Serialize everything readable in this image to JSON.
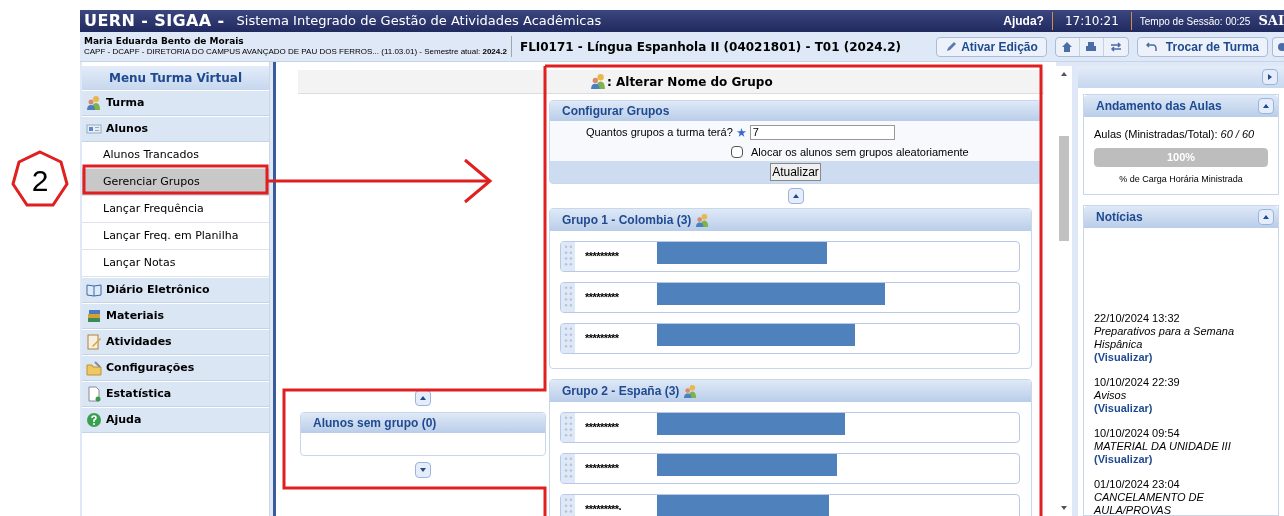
{
  "annotation": {
    "badge": "2"
  },
  "header": {
    "system": "UERN - SIGAA -",
    "title": "Sistema Integrado de Gestão de Atividades Acadêmicas",
    "help": "Ajuda?",
    "clock": "17:10:21",
    "session": "Tempo de Sessão: 00:25",
    "logout": "SAI"
  },
  "user": {
    "name": "Maria Eduarda Bento de Morais",
    "unit": "CAPF - DCAPF - DIRETORIA DO CAMPUS AVANÇADO DE PAU DOS FERROS... (11.03.01) - Semestre atual: **2024.2**"
  },
  "course": "FLI0171 - Língua Espanhola II (04021801) - T01 (2024.2)",
  "toolbar": {
    "edit": "Ativar Edição",
    "switch": "Trocar de Turma"
  },
  "sidebar": {
    "title": "Menu Turma Virtual",
    "items": [
      {
        "label": "Turma",
        "kind": "section",
        "selected": false
      },
      {
        "label": "Alunos",
        "kind": "section",
        "selected": false
      },
      {
        "label": "Alunos Trancados",
        "kind": "sub",
        "selected": false
      },
      {
        "label": "Gerenciar Grupos",
        "kind": "sub",
        "selected": true
      },
      {
        "label": "Lançar Frequência",
        "kind": "sub",
        "selected": false
      },
      {
        "label": "Lançar Freq. em Planilha",
        "kind": "sub",
        "selected": false
      },
      {
        "label": "Lançar Notas",
        "kind": "sub",
        "selected": false
      },
      {
        "label": "Diário Eletrônico",
        "kind": "section",
        "selected": false
      },
      {
        "label": "Materiais",
        "kind": "section",
        "selected": false
      },
      {
        "label": "Atividades",
        "kind": "section",
        "selected": false
      },
      {
        "label": "Configurações",
        "kind": "section",
        "selected": false
      },
      {
        "label": "Estatística",
        "kind": "section",
        "selected": false
      },
      {
        "label": "Ajuda",
        "kind": "section",
        "selected": false
      }
    ]
  },
  "legend": ": Alterar Nome do Grupo",
  "config": {
    "title": "Configurar Grupos",
    "question": "Quantos grupos a turma terá?",
    "value": "7",
    "random_label": "Alocar os alunos sem grupos aleatoriamente",
    "random_checked": false,
    "button": "Atualizar"
  },
  "unassigned": {
    "title": "Alunos sem grupo (0)"
  },
  "groups": [
    {
      "title": "Grupo 1 - Colombia (3)",
      "members": [
        "*********",
        "*********",
        "*********"
      ]
    },
    {
      "title": "Grupo 2 - España (3)",
      "members": [
        "*********",
        "*********",
        "*********·"
      ]
    }
  ],
  "progress": {
    "title": "Andamento das Aulas",
    "count": "Aulas (Ministradas/Total): *60 / 60*",
    "level": 1,
    "percent": "100%",
    "caption": "% de Carga Horária Ministrada"
  },
  "news": {
    "title": "Notícias",
    "items": [
      {
        "date": "22/10/2024 13:32",
        "title": "Preparativos para a Semana Hispânica",
        "link": "(Visualizar)"
      },
      {
        "date": "10/10/2024 22:39",
        "title": "Avisos",
        "link": "(Visualizar)"
      },
      {
        "date": "10/10/2024 09:54",
        "title": "MATERIAL DA UNIDADE III",
        "link": "(Visualizar)"
      },
      {
        "date": "01/10/2024 23:04",
        "title": "CANCELAMENTO DE AULA/PROVAS"
      }
    ]
  }
}
